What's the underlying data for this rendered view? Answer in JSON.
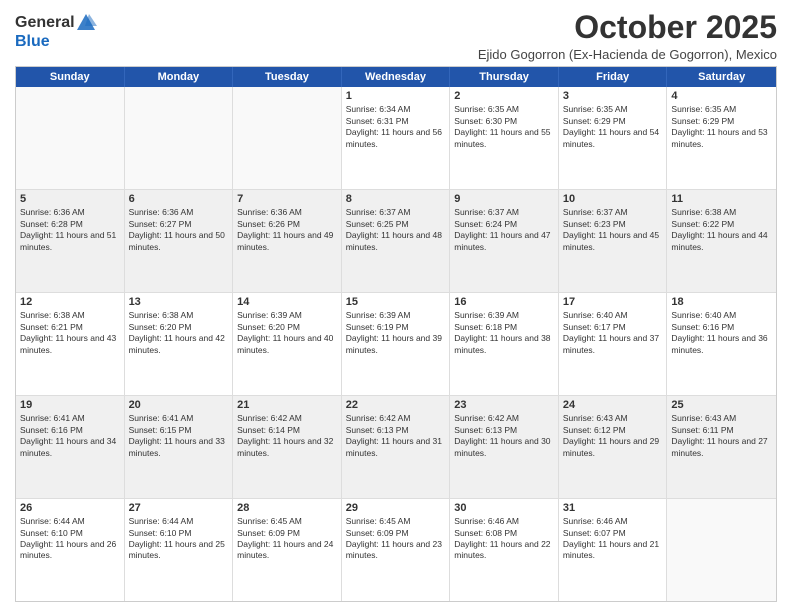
{
  "header": {
    "logo_general": "General",
    "logo_blue": "Blue",
    "month_title": "October 2025",
    "subtitle": "Ejido Gogorron (Ex-Hacienda de Gogorron), Mexico"
  },
  "weekdays": [
    "Sunday",
    "Monday",
    "Tuesday",
    "Wednesday",
    "Thursday",
    "Friday",
    "Saturday"
  ],
  "rows": [
    [
      {
        "day": "",
        "sunrise": "",
        "sunset": "",
        "daylight": "",
        "shaded": false,
        "empty": true
      },
      {
        "day": "",
        "sunrise": "",
        "sunset": "",
        "daylight": "",
        "shaded": false,
        "empty": true
      },
      {
        "day": "",
        "sunrise": "",
        "sunset": "",
        "daylight": "",
        "shaded": false,
        "empty": true
      },
      {
        "day": "1",
        "sunrise": "Sunrise: 6:34 AM",
        "sunset": "Sunset: 6:31 PM",
        "daylight": "Daylight: 11 hours and 56 minutes.",
        "shaded": false
      },
      {
        "day": "2",
        "sunrise": "Sunrise: 6:35 AM",
        "sunset": "Sunset: 6:30 PM",
        "daylight": "Daylight: 11 hours and 55 minutes.",
        "shaded": false
      },
      {
        "day": "3",
        "sunrise": "Sunrise: 6:35 AM",
        "sunset": "Sunset: 6:29 PM",
        "daylight": "Daylight: 11 hours and 54 minutes.",
        "shaded": false
      },
      {
        "day": "4",
        "sunrise": "Sunrise: 6:35 AM",
        "sunset": "Sunset: 6:29 PM",
        "daylight": "Daylight: 11 hours and 53 minutes.",
        "shaded": false
      }
    ],
    [
      {
        "day": "5",
        "sunrise": "Sunrise: 6:36 AM",
        "sunset": "Sunset: 6:28 PM",
        "daylight": "Daylight: 11 hours and 51 minutes.",
        "shaded": true
      },
      {
        "day": "6",
        "sunrise": "Sunrise: 6:36 AM",
        "sunset": "Sunset: 6:27 PM",
        "daylight": "Daylight: 11 hours and 50 minutes.",
        "shaded": true
      },
      {
        "day": "7",
        "sunrise": "Sunrise: 6:36 AM",
        "sunset": "Sunset: 6:26 PM",
        "daylight": "Daylight: 11 hours and 49 minutes.",
        "shaded": true
      },
      {
        "day": "8",
        "sunrise": "Sunrise: 6:37 AM",
        "sunset": "Sunset: 6:25 PM",
        "daylight": "Daylight: 11 hours and 48 minutes.",
        "shaded": true
      },
      {
        "day": "9",
        "sunrise": "Sunrise: 6:37 AM",
        "sunset": "Sunset: 6:24 PM",
        "daylight": "Daylight: 11 hours and 47 minutes.",
        "shaded": true
      },
      {
        "day": "10",
        "sunrise": "Sunrise: 6:37 AM",
        "sunset": "Sunset: 6:23 PM",
        "daylight": "Daylight: 11 hours and 45 minutes.",
        "shaded": true
      },
      {
        "day": "11",
        "sunrise": "Sunrise: 6:38 AM",
        "sunset": "Sunset: 6:22 PM",
        "daylight": "Daylight: 11 hours and 44 minutes.",
        "shaded": true
      }
    ],
    [
      {
        "day": "12",
        "sunrise": "Sunrise: 6:38 AM",
        "sunset": "Sunset: 6:21 PM",
        "daylight": "Daylight: 11 hours and 43 minutes.",
        "shaded": false
      },
      {
        "day": "13",
        "sunrise": "Sunrise: 6:38 AM",
        "sunset": "Sunset: 6:20 PM",
        "daylight": "Daylight: 11 hours and 42 minutes.",
        "shaded": false
      },
      {
        "day": "14",
        "sunrise": "Sunrise: 6:39 AM",
        "sunset": "Sunset: 6:20 PM",
        "daylight": "Daylight: 11 hours and 40 minutes.",
        "shaded": false
      },
      {
        "day": "15",
        "sunrise": "Sunrise: 6:39 AM",
        "sunset": "Sunset: 6:19 PM",
        "daylight": "Daylight: 11 hours and 39 minutes.",
        "shaded": false
      },
      {
        "day": "16",
        "sunrise": "Sunrise: 6:39 AM",
        "sunset": "Sunset: 6:18 PM",
        "daylight": "Daylight: 11 hours and 38 minutes.",
        "shaded": false
      },
      {
        "day": "17",
        "sunrise": "Sunrise: 6:40 AM",
        "sunset": "Sunset: 6:17 PM",
        "daylight": "Daylight: 11 hours and 37 minutes.",
        "shaded": false
      },
      {
        "day": "18",
        "sunrise": "Sunrise: 6:40 AM",
        "sunset": "Sunset: 6:16 PM",
        "daylight": "Daylight: 11 hours and 36 minutes.",
        "shaded": false
      }
    ],
    [
      {
        "day": "19",
        "sunrise": "Sunrise: 6:41 AM",
        "sunset": "Sunset: 6:16 PM",
        "daylight": "Daylight: 11 hours and 34 minutes.",
        "shaded": true
      },
      {
        "day": "20",
        "sunrise": "Sunrise: 6:41 AM",
        "sunset": "Sunset: 6:15 PM",
        "daylight": "Daylight: 11 hours and 33 minutes.",
        "shaded": true
      },
      {
        "day": "21",
        "sunrise": "Sunrise: 6:42 AM",
        "sunset": "Sunset: 6:14 PM",
        "daylight": "Daylight: 11 hours and 32 minutes.",
        "shaded": true
      },
      {
        "day": "22",
        "sunrise": "Sunrise: 6:42 AM",
        "sunset": "Sunset: 6:13 PM",
        "daylight": "Daylight: 11 hours and 31 minutes.",
        "shaded": true
      },
      {
        "day": "23",
        "sunrise": "Sunrise: 6:42 AM",
        "sunset": "Sunset: 6:13 PM",
        "daylight": "Daylight: 11 hours and 30 minutes.",
        "shaded": true
      },
      {
        "day": "24",
        "sunrise": "Sunrise: 6:43 AM",
        "sunset": "Sunset: 6:12 PM",
        "daylight": "Daylight: 11 hours and 29 minutes.",
        "shaded": true
      },
      {
        "day": "25",
        "sunrise": "Sunrise: 6:43 AM",
        "sunset": "Sunset: 6:11 PM",
        "daylight": "Daylight: 11 hours and 27 minutes.",
        "shaded": true
      }
    ],
    [
      {
        "day": "26",
        "sunrise": "Sunrise: 6:44 AM",
        "sunset": "Sunset: 6:10 PM",
        "daylight": "Daylight: 11 hours and 26 minutes.",
        "shaded": false
      },
      {
        "day": "27",
        "sunrise": "Sunrise: 6:44 AM",
        "sunset": "Sunset: 6:10 PM",
        "daylight": "Daylight: 11 hours and 25 minutes.",
        "shaded": false
      },
      {
        "day": "28",
        "sunrise": "Sunrise: 6:45 AM",
        "sunset": "Sunset: 6:09 PM",
        "daylight": "Daylight: 11 hours and 24 minutes.",
        "shaded": false
      },
      {
        "day": "29",
        "sunrise": "Sunrise: 6:45 AM",
        "sunset": "Sunset: 6:09 PM",
        "daylight": "Daylight: 11 hours and 23 minutes.",
        "shaded": false
      },
      {
        "day": "30",
        "sunrise": "Sunrise: 6:46 AM",
        "sunset": "Sunset: 6:08 PM",
        "daylight": "Daylight: 11 hours and 22 minutes.",
        "shaded": false
      },
      {
        "day": "31",
        "sunrise": "Sunrise: 6:46 AM",
        "sunset": "Sunset: 6:07 PM",
        "daylight": "Daylight: 11 hours and 21 minutes.",
        "shaded": false
      },
      {
        "day": "",
        "sunrise": "",
        "sunset": "",
        "daylight": "",
        "shaded": false,
        "empty": true
      }
    ]
  ]
}
